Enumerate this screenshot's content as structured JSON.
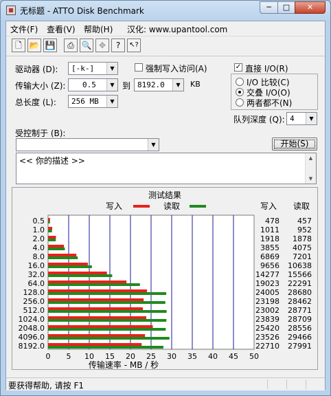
{
  "window": {
    "title": "无标题 - ATTO Disk Benchmark",
    "minimize": "─",
    "maximize": "□",
    "close": "✕"
  },
  "menu": {
    "file": "文件(F)",
    "view": "查看(V)",
    "help": "帮助(H)",
    "credit": "汉化: www.upantool.com"
  },
  "toolbar": [
    {
      "name": "new-icon",
      "glyph": "🗋"
    },
    {
      "name": "open-icon",
      "glyph": "📂"
    },
    {
      "name": "save-icon",
      "glyph": "💾"
    },
    {
      "name": "print-icon",
      "glyph": "⎙"
    },
    {
      "name": "print-preview-icon",
      "glyph": "🔍"
    },
    {
      "name": "move-icon",
      "glyph": "✥"
    },
    {
      "name": "help-icon",
      "glyph": "?"
    },
    {
      "name": "context-help-icon",
      "glyph": "↖?"
    }
  ],
  "settings": {
    "drive_label": "驱动器 (D):",
    "drive_value": "[-k-]",
    "force_write_label": "强制写入访问(A)",
    "transfer_label": "传输大小 (Z):",
    "transfer_from": "0.5",
    "to_label": "到",
    "transfer_to": "8192.0",
    "kb_label": "KB",
    "total_label": "总长度 (L):",
    "total_value": "256 MB",
    "direct_io_label": "直接 I/O(R)",
    "io_compare_label": "I/O 比较(C)",
    "overlap_label": "交叠 I/O(O)",
    "neither_label": "两者都不(N)",
    "queue_label": "队列深度 (Q):",
    "queue_value": "4",
    "controlled_label": "受控制于 (B):",
    "controlled_value": "",
    "start_button": "开始(S)",
    "description": "<<  你的描述   >>"
  },
  "chart_data": {
    "type": "bar",
    "title": "测试结果",
    "legend": {
      "write": "写入",
      "read": "读取"
    },
    "colors": {
      "write": "#e8221a",
      "read": "#1f8a1f"
    },
    "xlabel": "传输速率 - MB / 秒",
    "xlim": [
      0,
      50
    ],
    "xticks": [
      0,
      5,
      10,
      15,
      20,
      25,
      30,
      35,
      40,
      45,
      50
    ],
    "col_headers": {
      "write": "写入",
      "read": "读取"
    },
    "categories": [
      "0.5",
      "1.0",
      "2.0",
      "4.0",
      "8.0",
      "16.0",
      "32.0",
      "64.0",
      "128.0",
      "256.0",
      "512.0",
      "1024.0",
      "2048.0",
      "4096.0",
      "8192.0"
    ],
    "series": [
      {
        "name": "写入",
        "values": [
          478,
          1011,
          1918,
          3855,
          6869,
          9656,
          14277,
          19023,
          24005,
          23198,
          23002,
          23839,
          25420,
          23526,
          22710
        ]
      },
      {
        "name": "读取",
        "values": [
          457,
          952,
          1878,
          4075,
          7201,
          10638,
          15566,
          22291,
          28680,
          28462,
          28771,
          28709,
          28556,
          29466,
          27991
        ]
      }
    ]
  },
  "status": {
    "text": "要获得帮助, 请按 F1"
  }
}
